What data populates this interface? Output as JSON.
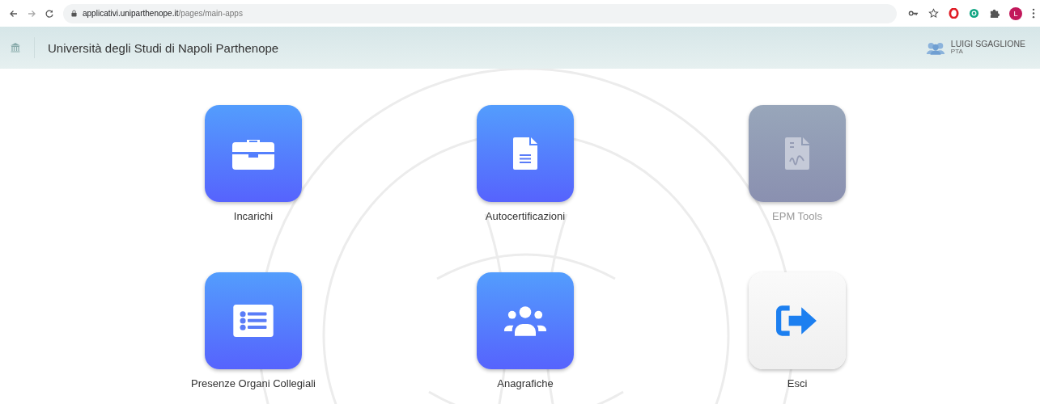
{
  "browser": {
    "url_host": "applicativi.uniparthenope.it",
    "url_path": "/pages/main-apps",
    "profile_initial": "L"
  },
  "header": {
    "title": "Università degli Studi di Napoli Parthenope",
    "user_name": "LUIGI SGAGLIONE",
    "user_role": "PTA"
  },
  "apps": [
    {
      "label": "Incarichi",
      "kind": "blue",
      "disabled": false
    },
    {
      "label": "Autocertificazioni",
      "kind": "blue",
      "disabled": false
    },
    {
      "label": "EPM Tools",
      "kind": "grey",
      "disabled": true
    },
    {
      "label": "Presenze Organi Collegiali",
      "kind": "blue",
      "disabled": false
    },
    {
      "label": "Anagrafiche",
      "kind": "blue",
      "disabled": false
    },
    {
      "label": "Esci",
      "kind": "white",
      "disabled": false
    }
  ]
}
